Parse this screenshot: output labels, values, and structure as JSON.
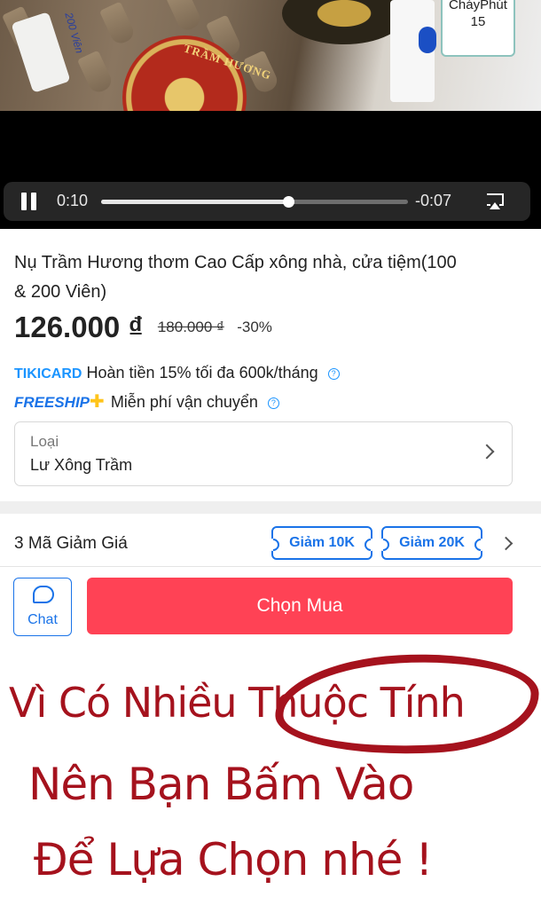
{
  "video": {
    "timer_badge_line1": "Cháy",
    "timer_badge_line2": "Phút",
    "timer_badge_value": "15",
    "tag_text": "200 Viên",
    "seal_text": "TRẦM HƯƠNG",
    "current_time": "0:10",
    "remaining_time": "-0:07",
    "progress_fraction": 0.61,
    "state": "playing"
  },
  "product": {
    "title": "Nụ Trầm Hương thơm Cao Cấp xông nhà, cửa tiệm(100 & 200 Viên)",
    "price": "126.000 ₫",
    "old_price": "180.000 ₫",
    "discount": "-30%"
  },
  "promos": {
    "tiki_logo": "TIKICARD",
    "tiki_text": "Hoàn tiền 15% tối đa 600k/tháng",
    "ship_logo": "FREESHIP",
    "ship_text": "Miễn phí vận chuyển"
  },
  "variant": {
    "label": "Loại",
    "value": "Lư Xông Trầm"
  },
  "coupons": {
    "title": "3 Mã Giảm Giá",
    "items": [
      "Giảm 10K",
      "Giảm 20K"
    ]
  },
  "actions": {
    "chat_label": "Chat",
    "buy_label": "Chọn Mua"
  },
  "caption": {
    "line1": "Vì Có Nhiều Thuộc Tính",
    "line2": "Nên Bạn Bấm Vào",
    "line3": "Để Lựa Chọn nhé !"
  },
  "colors": {
    "accent_blue": "#1a73e8",
    "buy_red": "#ff4255",
    "caption_red": "#a5121d"
  }
}
